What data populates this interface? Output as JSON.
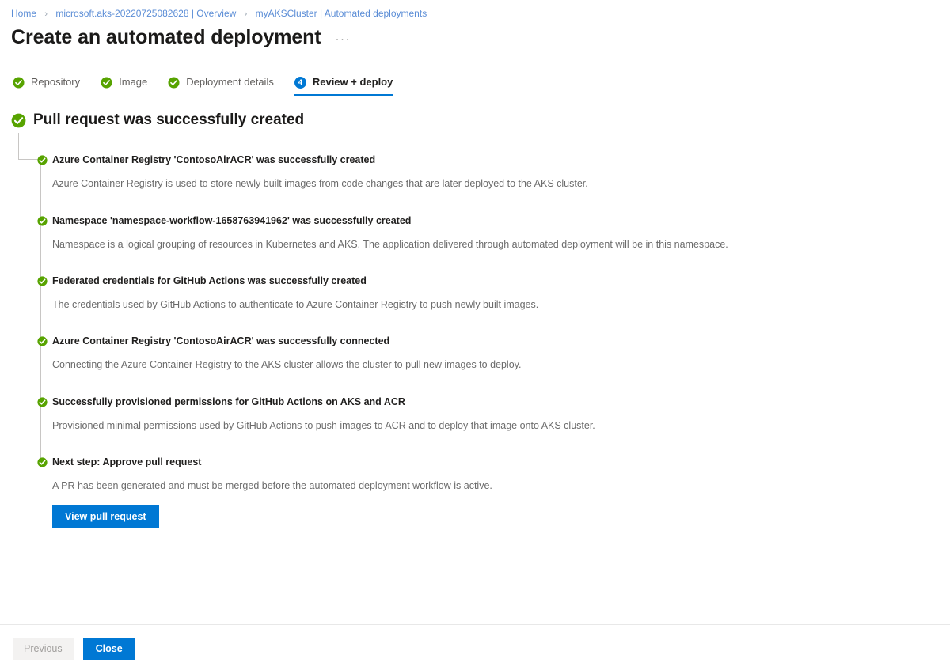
{
  "breadcrumb": {
    "separator": "›",
    "items": [
      {
        "label": "Home"
      },
      {
        "label": "microsoft.aks-20220725082628 | Overview"
      },
      {
        "label": "myAKSCluster | Automated deployments"
      }
    ]
  },
  "header": {
    "title": "Create an automated deployment",
    "more_menu": "···"
  },
  "wizard": {
    "tabs": [
      {
        "label": "Repository",
        "state": "complete",
        "icon": "check-circle-icon"
      },
      {
        "label": "Image",
        "state": "complete",
        "icon": "check-circle-icon"
      },
      {
        "label": "Deployment details",
        "state": "complete",
        "icon": "check-circle-icon"
      },
      {
        "label": "Review + deploy",
        "state": "active",
        "number": "4"
      }
    ]
  },
  "result": {
    "heading": "Pull request was successfully created",
    "heading_icon": "check-circle-icon",
    "steps": [
      {
        "title": "Azure Container Registry 'ContosoAirACR' was successfully created",
        "description": "Azure Container Registry is used to store newly built images from code changes that are later deployed to the AKS cluster."
      },
      {
        "title": "Namespace 'namespace-workflow-1658763941962' was successfully created",
        "description": "Namespace is a logical grouping of resources in Kubernetes and AKS. The application delivered through automated deployment will be in this namespace."
      },
      {
        "title": "Federated credentials for GitHub Actions was successfully created",
        "description": "The credentials used by GitHub Actions to authenticate to Azure Container Registry to push newly built images."
      },
      {
        "title": "Azure Container Registry 'ContosoAirACR' was successfully connected",
        "description": "Connecting the Azure Container Registry to the AKS cluster allows the cluster to pull new images to deploy."
      },
      {
        "title": "Successfully provisioned permissions for GitHub Actions on AKS and ACR",
        "description": "Provisioned minimal permissions used by GitHub Actions to push images to ACR and to deploy that image onto AKS cluster."
      },
      {
        "title": "Next step: Approve pull request",
        "description": "A PR has been generated and must be merged before the automated deployment workflow is active.",
        "action_label": "View pull request"
      }
    ]
  },
  "footer": {
    "previous_label": "Previous",
    "previous_disabled": true,
    "close_label": "Close"
  },
  "colors": {
    "accent_blue": "#0078d4",
    "success_green": "#57a300",
    "link_blue": "#5b8dd6",
    "connector_grey": "#c8c6c4",
    "text_primary": "#201f1e",
    "text_secondary": "#6b6b6b",
    "disabled_bg": "#f3f2f1"
  }
}
